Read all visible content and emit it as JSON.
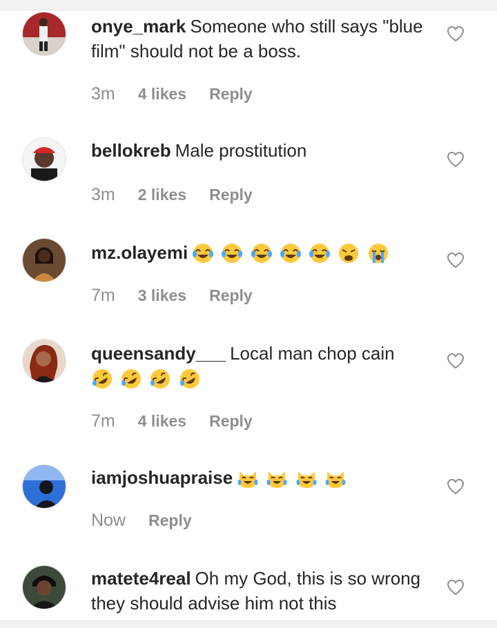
{
  "comments": [
    {
      "username": "onye_mark",
      "text": "Someone who still says \"blue film\" should not be a boss.",
      "time": "3m",
      "likes": "4 likes",
      "reply": "Reply",
      "emojis": []
    },
    {
      "username": "bellokreb",
      "text": "Male prostitution",
      "time": "3m",
      "likes": "2 likes",
      "reply": "Reply",
      "emojis": []
    },
    {
      "username": "mz.olayemi",
      "text": "",
      "time": "7m",
      "likes": "3 likes",
      "reply": "Reply",
      "emojis": [
        "tears-of-joy",
        "tears-of-joy",
        "tears-of-joy",
        "tears-of-joy",
        "tears-of-joy",
        "weary-face",
        "loudly-crying-face"
      ]
    },
    {
      "username": "queensandy___",
      "text": "Local man chop cain",
      "time": "7m",
      "likes": "4 likes",
      "reply": "Reply",
      "emojis": [
        "rolling-on-floor-laughing",
        "rolling-on-floor-laughing",
        "rolling-on-floor-laughing",
        "rolling-on-floor-laughing"
      ]
    },
    {
      "username": "iamjoshuapraise",
      "text": "",
      "time": "Now",
      "likes": "",
      "reply": "Reply",
      "emojis": [
        "cat-tears-of-joy",
        "cat-tears-of-joy",
        "cat-tears-of-joy",
        "cat-tears-of-joy"
      ]
    },
    {
      "username": "matete4real",
      "text": "Oh my God, this is so wrong they should advise him not this",
      "time": "",
      "likes": "",
      "reply": "",
      "emojis": []
    }
  ],
  "icons": {
    "like": "heart-outline-icon"
  },
  "colors": {
    "text": "#262626",
    "meta": "#8e8e8e",
    "emoji": "#ffc93b"
  }
}
